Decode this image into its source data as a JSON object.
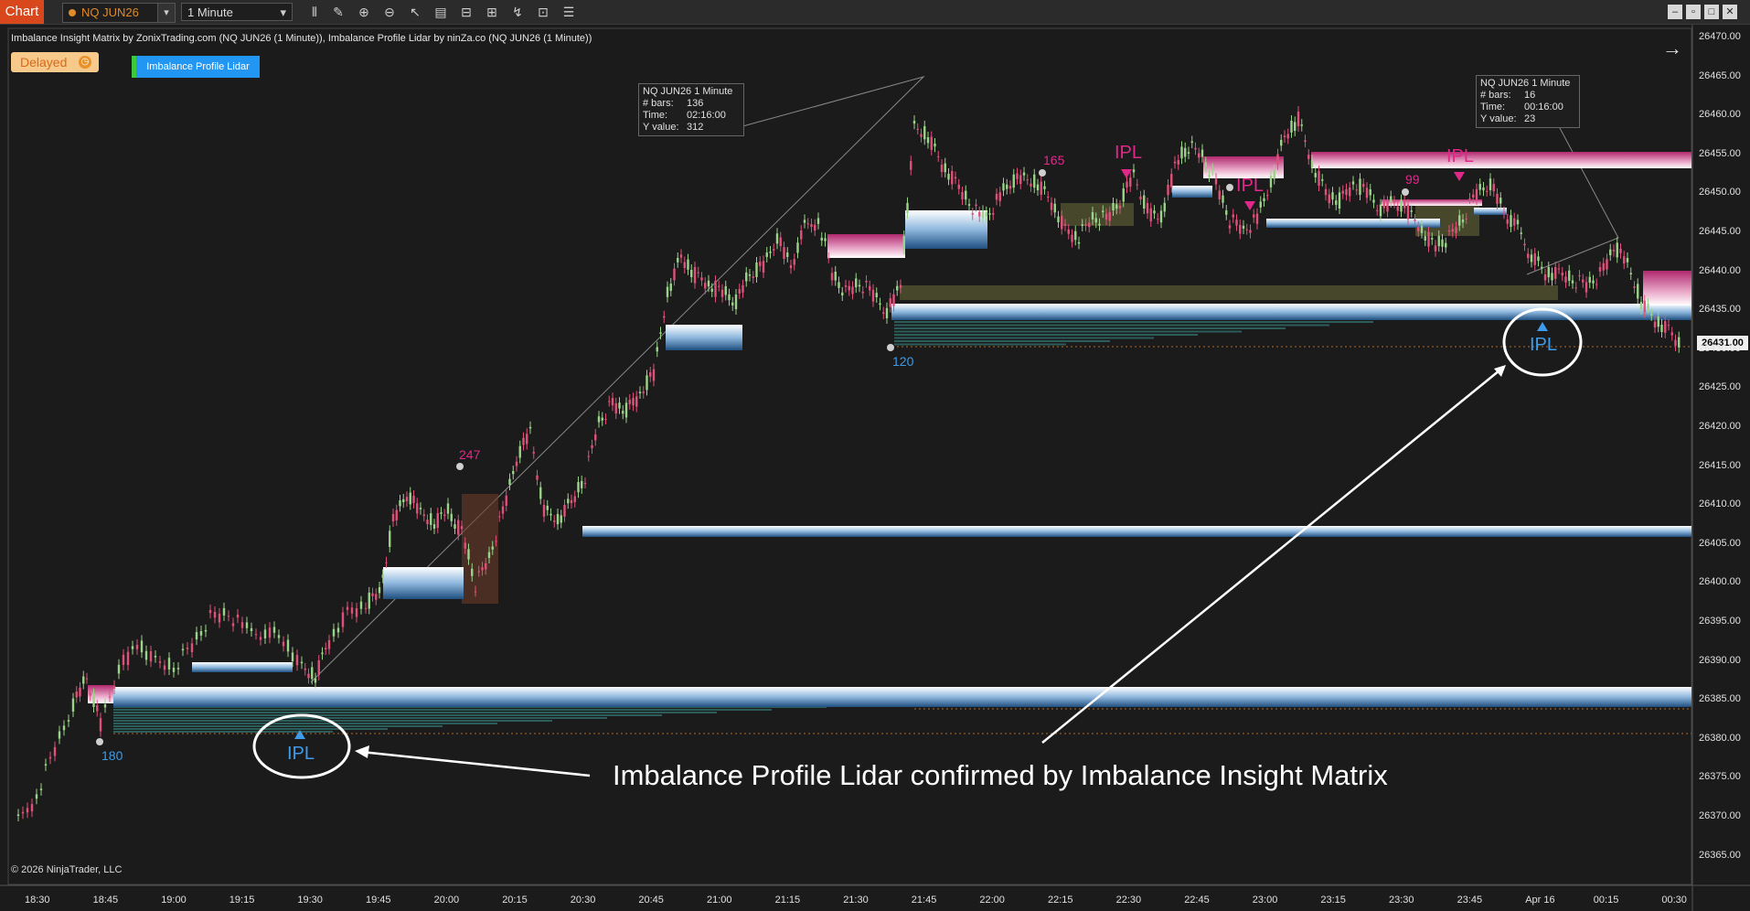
{
  "toolbar": {
    "tab_label": "Chart",
    "instrument": "NQ JUN26",
    "interval": "1 Minute",
    "tools": [
      "bar-style-icon",
      "draw-icon",
      "zoom-in-icon",
      "zoom-out-icon",
      "pointer-icon",
      "data-box-icon",
      "properties-icon",
      "strategies-icon",
      "indicators-icon",
      "templates-icon",
      "more-icon"
    ]
  },
  "chart": {
    "indicator_title": "Imbalance Insight Matrix by ZonixTrading.com (NQ JUN26 (1 Minute)), Imbalance Profile Lidar by ninZa.co (NQ JUN26 (1 Minute))",
    "delayed_label": "Delayed",
    "ipl_button_label": "Imbalance Profile Lidar",
    "copyright": "© 2026 NinjaTrader, LLC",
    "annotation": "Imbalance Profile Lidar confirmed by Imbalance Insight Matrix",
    "current_price": "26431.00",
    "ipl_labels": [
      "IPL",
      "IPL",
      "IPL",
      "IPL",
      "IPL"
    ],
    "pivot_numbers": [
      "247",
      "165",
      "99",
      "180",
      "120"
    ],
    "price_axis": [
      "26470.00",
      "26465.00",
      "26460.00",
      "26455.00",
      "26450.00",
      "26445.00",
      "26440.00",
      "26435.00",
      "26430.00",
      "26425.00",
      "26420.00",
      "26415.00",
      "26410.00",
      "26405.00",
      "26400.00",
      "26395.00",
      "26390.00",
      "26385.00",
      "26380.00",
      "26375.00",
      "26370.00",
      "26365.00"
    ],
    "time_axis": [
      "18:30",
      "18:45",
      "19:00",
      "19:15",
      "19:30",
      "19:45",
      "20:00",
      "20:15",
      "20:30",
      "20:45",
      "21:00",
      "21:15",
      "21:30",
      "21:45",
      "22:00",
      "22:15",
      "22:30",
      "22:45",
      "23:00",
      "23:15",
      "23:30",
      "23:45",
      "Apr 16",
      "00:15",
      "00:30"
    ],
    "tooltip1": {
      "title": "NQ JUN26 1 Minute",
      "bars_label": "# bars:",
      "bars": "136",
      "time_label": "Time:",
      "time": "02:16:00",
      "y_label": "Y value:",
      "y": "312"
    },
    "tooltip2": {
      "title": "NQ JUN26 1 Minute",
      "bars_label": "# bars:",
      "bars": "16",
      "time_label": "Time:",
      "time": "00:16:00",
      "y_label": "Y value:",
      "y": "23"
    },
    "colors": {
      "background": "#1b1b1b",
      "up_candle": "#9bd38a",
      "down_candle": "#e0507a",
      "ipl_blue": "#3d9be9",
      "ipl_pink": "#e0288a",
      "annotation": "#ffffff"
    }
  }
}
